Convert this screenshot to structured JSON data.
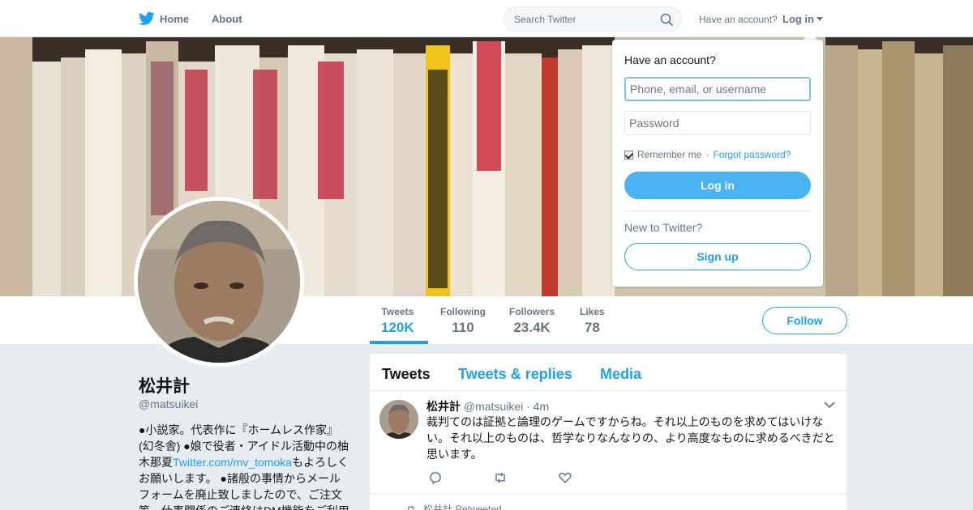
{
  "nav": {
    "home_label": "Home",
    "about_label": "About",
    "search_placeholder": "Search Twitter",
    "have_account": "Have an account?",
    "login_label": "Log in"
  },
  "profile": {
    "name": "松井計",
    "handle": "@matsuikei",
    "bio_part1": "●小説家。代表作に『ホームレス作家』(幻冬舎) ●娘で役者・アイドル活動中の柚木那夏",
    "bio_link": "Twitter.com/mv_tomoka",
    "bio_part2": "もよろしくお願いします。 ●諸般の事情からメールフォームを廃止致しましたので、ご注文等、仕事関係のご連絡はDM機能をご利用ください。",
    "stats": [
      {
        "label": "Tweets",
        "value": "120K"
      },
      {
        "label": "Following",
        "value": "110"
      },
      {
        "label": "Followers",
        "value": "23.4K"
      },
      {
        "label": "Likes",
        "value": "78"
      }
    ],
    "follow_label": "Follow"
  },
  "timeline": {
    "tabs": [
      "Tweets",
      "Tweets & replies",
      "Media"
    ],
    "tweet": {
      "name": "松井計",
      "handle": "@matsuikei",
      "time": "· 4m",
      "text": "裁判てのは証拠と論理のゲームですからね。それ以上のものを求めてはいけない。それ以上のものは、哲学なりなんなりの、より高度なものに求めるべきだと思います。"
    },
    "retweeted": "松井計 Retweeted"
  },
  "login": {
    "title": "Have an account?",
    "username_placeholder": "Phone, email, or username",
    "password_placeholder": "Password",
    "remember": "Remember me",
    "separator": "·",
    "forgot": "Forgot password?",
    "login_button": "Log in",
    "new_to": "New to Twitter?",
    "signup_button": "Sign up"
  },
  "colors": {
    "accent": "#1da1f2",
    "login_button": "#4ab3f4",
    "background": "#e6ecf0"
  },
  "icons": [
    "twitter-bird-icon",
    "search-icon",
    "caret-down-icon",
    "reply-icon",
    "retweet-icon",
    "like-icon",
    "chevron-down-icon"
  ]
}
